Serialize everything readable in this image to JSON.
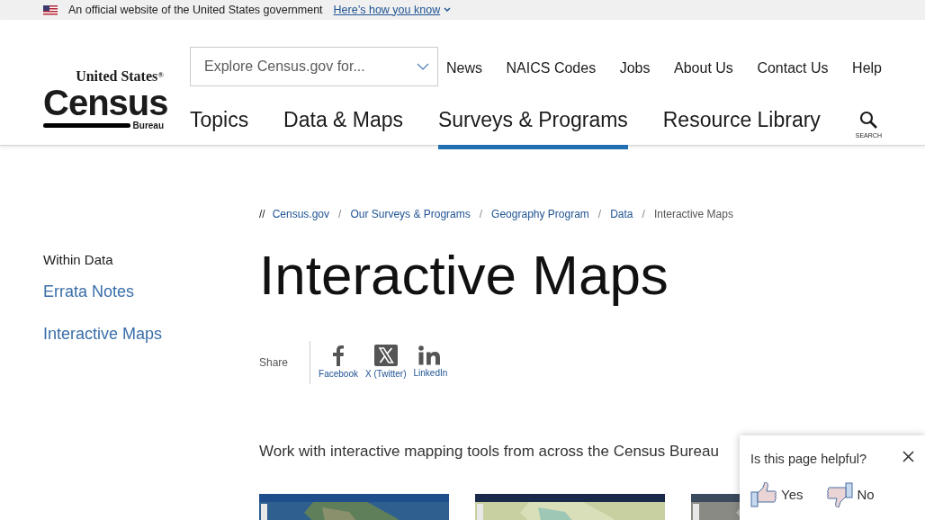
{
  "banner": {
    "text": "An official website of the United States government",
    "link": "Here’s how you know"
  },
  "logo": {
    "top": "United States$^{®}$",
    "main": "Census",
    "bottom": "Bureau"
  },
  "search": {
    "placeholder": "Explore Census.gov for..."
  },
  "utility_links": [
    "News",
    "NAICS Codes",
    "Jobs",
    "About Us",
    "Contact Us",
    "Help"
  ],
  "main_nav": [
    {
      "label": "Topics",
      "selected": false
    },
    {
      "label": "Data & Maps",
      "selected": false
    },
    {
      "label": "Surveys & Programs",
      "selected": true
    },
    {
      "label": "Resource Library",
      "selected": false
    }
  ],
  "search_button": {
    "label": "SEARCH"
  },
  "sidebar": {
    "heading": "Within Data",
    "items": [
      "Errata Notes",
      "Interactive Maps"
    ]
  },
  "breadcrumb": {
    "prefix": "//",
    "separator": "/",
    "items": [
      {
        "label": "Census.gov",
        "current": false
      },
      {
        "label": "Our Surveys & Programs",
        "current": false
      },
      {
        "label": "Geography Program",
        "current": false
      },
      {
        "label": "Data",
        "current": false
      },
      {
        "label": "Interactive Maps",
        "current": true
      }
    ]
  },
  "title": "Interactive Maps",
  "share": {
    "label": "Share",
    "links": [
      {
        "kind": "facebook",
        "label": "Facebook"
      },
      {
        "kind": "x",
        "label": "X (Twitter)"
      },
      {
        "kind": "linkedin",
        "label": "LinkedIn"
      }
    ]
  },
  "intro": "Work with interactive mapping tools from across the Census Bureau",
  "feedback": {
    "question": "Is this page helpful?",
    "options": [
      {
        "kind": "yes",
        "label": "Yes"
      },
      {
        "kind": "no",
        "label": "No"
      }
    ]
  }
}
